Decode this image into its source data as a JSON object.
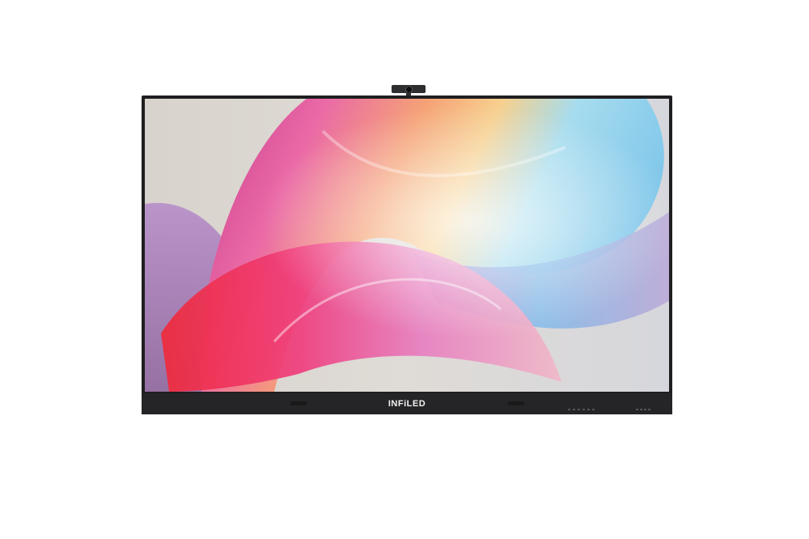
{
  "display": {
    "brand_text": "INFiLED"
  },
  "colors": {
    "bezel": "#1f1f21",
    "bottom_bar": "#252527",
    "background": "#ffffff",
    "wallpaper_warm": "#e8456a",
    "wallpaper_cool": "#8fd6ee",
    "wallpaper_accent": "#f2c06a"
  },
  "icons": [
    "camera-icon",
    "speaker-icon",
    "button-icon"
  ]
}
